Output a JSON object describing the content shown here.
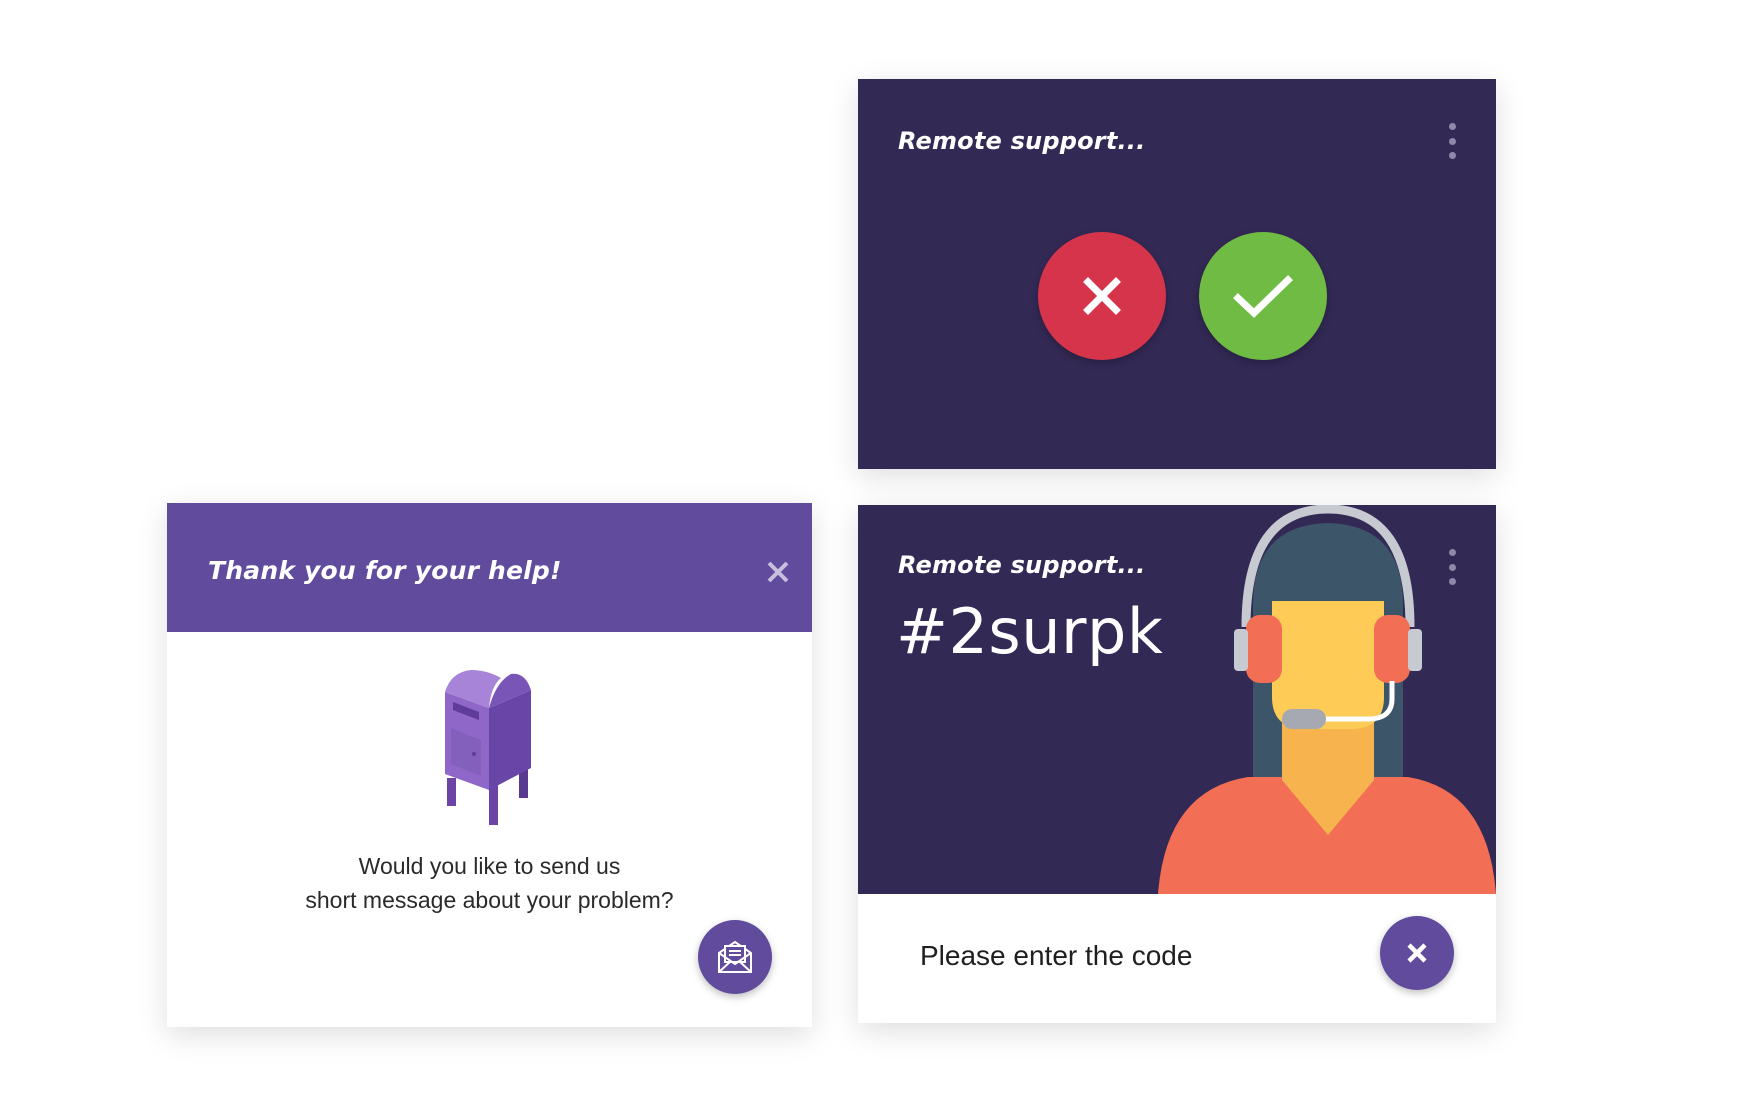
{
  "colors": {
    "dark_navy": "#332955",
    "purple": "#604b9d",
    "decline_red": "#d5344a",
    "accept_green": "#6fbb44",
    "white": "#ffffff"
  },
  "decision_card": {
    "title": "Remote support...",
    "menu_icon": "kebab-menu-icon",
    "decline_icon": "close-icon",
    "accept_icon": "checkmark-icon"
  },
  "thanks_card": {
    "title": "Thank you for your help!",
    "close_icon": "close-icon",
    "illustration": "mailbox-icon",
    "message_line_1": "Would you like to send us",
    "message_line_2": "short message about your problem?",
    "send_icon": "envelope-icon"
  },
  "code_card": {
    "title": "Remote support...",
    "code": "#2surpk",
    "menu_icon": "kebab-menu-icon",
    "illustration": "support-agent-headset-icon",
    "prompt": "Please enter the code",
    "cancel_icon": "close-icon"
  }
}
